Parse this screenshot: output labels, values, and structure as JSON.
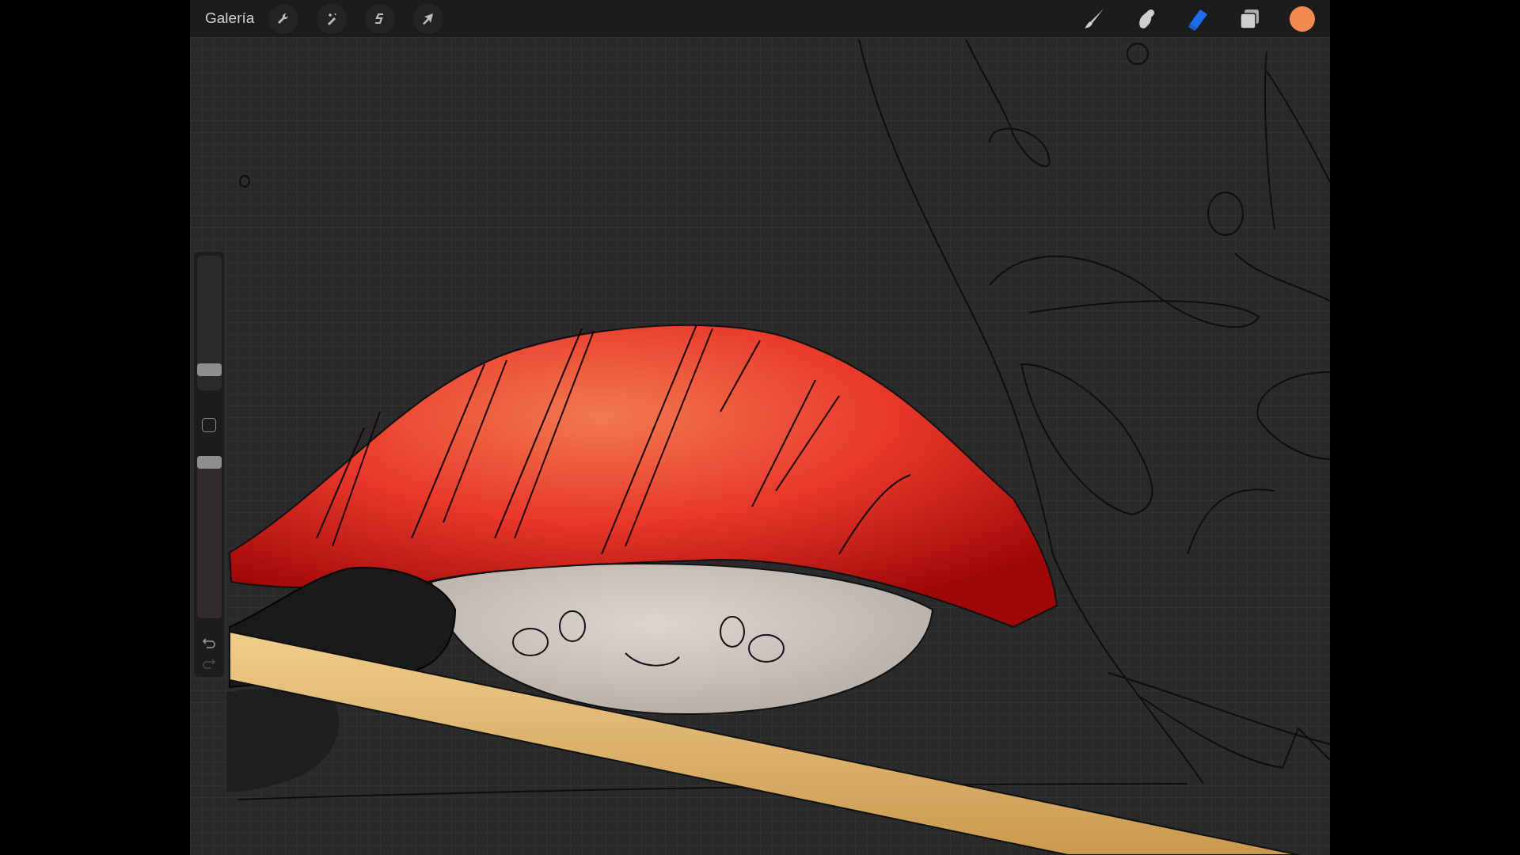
{
  "top_bar": {
    "gallery_link": "Galería",
    "actions": [
      {
        "kind": "wrench"
      },
      {
        "kind": "wand"
      },
      {
        "kind": "selection"
      },
      {
        "kind": "transform"
      }
    ],
    "tools": [
      {
        "kind": "brush",
        "selected": false
      },
      {
        "kind": "smudge",
        "selected": false
      },
      {
        "kind": "eraser",
        "selected": true
      },
      {
        "kind": "layers",
        "selected": false
      }
    ],
    "color_swatch": {
      "color": "#f28a50"
    }
  },
  "sidebar": {
    "size_slider": {
      "level": 0.12
    },
    "opacity_slider": {
      "level": 1
    }
  }
}
